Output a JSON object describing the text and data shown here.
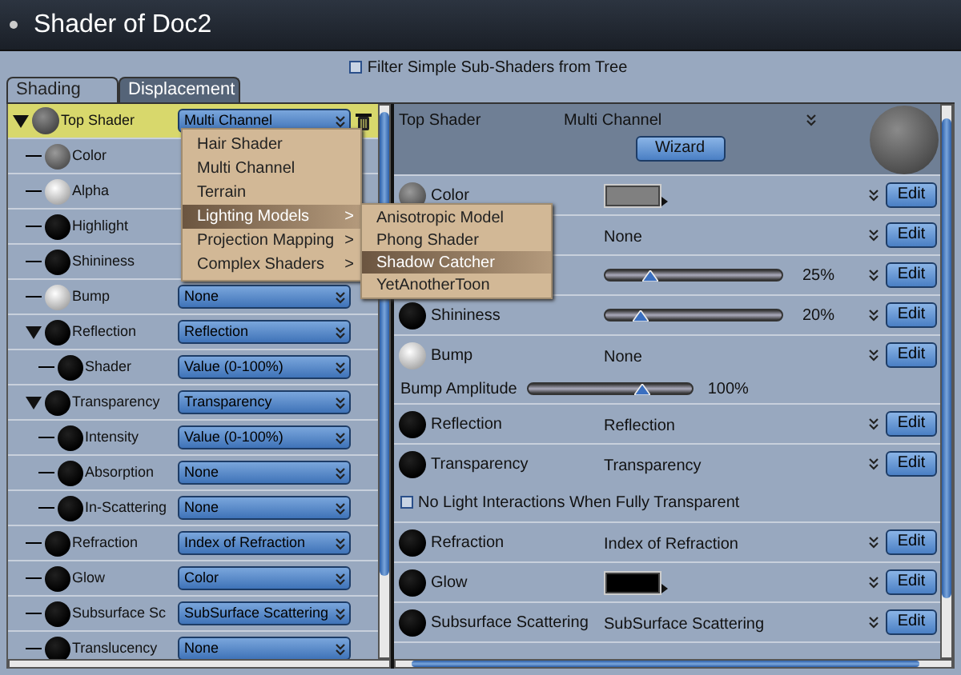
{
  "window": {
    "title": "Shader of Doc2"
  },
  "filter": {
    "label": "Filter Simple Sub-Shaders from Tree",
    "checked": false
  },
  "tabs": [
    {
      "label": "Shading",
      "selected": true
    },
    {
      "label": "Displacement",
      "selected": false
    }
  ],
  "tree": [
    {
      "label": "Top Shader",
      "sphere": {
        "kind": "dark"
      },
      "value": "Multi Channel",
      "selected": true,
      "expanded": true,
      "children": [
        {
          "label": "Color",
          "sphere": {
            "kind": "gray"
          },
          "selected": false
        },
        {
          "label": "Alpha",
          "sphere": {
            "kind": "white"
          },
          "selected": false
        },
        {
          "label": "Highlight",
          "sphere": {
            "kind": "black"
          },
          "selected": false
        },
        {
          "label": "Shininess",
          "sphere": {
            "kind": "black"
          },
          "selected": false
        },
        {
          "label": "Bump",
          "sphere": {
            "kind": "white"
          },
          "value": "None",
          "selected": false
        },
        {
          "label": "Reflection",
          "sphere": {
            "kind": "black"
          },
          "value": "Reflection",
          "selected": false,
          "expanded": true,
          "children": [
            {
              "label": "Shader",
              "sphere": {
                "kind": "black"
              },
              "value": "Value (0-100%)",
              "selected": false
            }
          ]
        },
        {
          "label": "Transparency",
          "sphere": {
            "kind": "black"
          },
          "value": "Transparency",
          "selected": false,
          "expanded": true,
          "children": [
            {
              "label": "Intensity",
              "sphere": {
                "kind": "black"
              },
              "value": "Value (0-100%)",
              "selected": false
            },
            {
              "label": "Absorption",
              "sphere": {
                "kind": "black"
              },
              "value": "None",
              "selected": false
            },
            {
              "label": "In-Scattering",
              "sphere": {
                "kind": "black"
              },
              "value": "None",
              "selected": false
            }
          ]
        },
        {
          "label": "Refraction",
          "sphere": {
            "kind": "black"
          },
          "value": "Index of Refraction",
          "selected": false
        },
        {
          "label": "Glow",
          "sphere": {
            "kind": "black"
          },
          "value": "Color",
          "selected": false
        },
        {
          "label": "Subsurface Sc",
          "sphere": {
            "kind": "black"
          },
          "value": "SubSurface Scattering",
          "selected": false
        },
        {
          "label": "Translucency",
          "sphere": {
            "kind": "black"
          },
          "value": "None",
          "selected": false
        }
      ]
    }
  ],
  "menu": {
    "items": [
      {
        "label": "Hair Shader",
        "submenu": false,
        "selected": false
      },
      {
        "label": "Multi Channel",
        "submenu": false,
        "selected": false
      },
      {
        "label": "Terrain",
        "submenu": false,
        "selected": false
      },
      {
        "label": "Lighting Models",
        "submenu": true,
        "selected": true
      },
      {
        "label": "Projection Mapping",
        "submenu": true,
        "selected": false
      },
      {
        "label": "Complex Shaders",
        "submenu": true,
        "selected": false
      }
    ],
    "arrow": ">",
    "submenu": [
      {
        "label": "Anisotropic Model",
        "selected": false
      },
      {
        "label": "Phong Shader",
        "selected": false
      },
      {
        "label": "Shadow Catcher",
        "selected": true
      },
      {
        "label": "YetAnotherToon",
        "selected": false
      }
    ]
  },
  "detail": {
    "title": "Top Shader",
    "value": "Multi Channel",
    "wizard": "Wizard",
    "rows": [
      {
        "kind": "swatch",
        "label": "Color",
        "sphere": {
          "kind": "gray"
        },
        "color": "#808080",
        "edit": "Edit"
      },
      {
        "kind": "value",
        "value": "None",
        "edit": "Edit"
      },
      {
        "kind": "slider",
        "level": 0.25,
        "reading": "25%",
        "edit": "Edit"
      },
      {
        "kind": "slider",
        "label": "Shininess",
        "sphere": {
          "kind": "black"
        },
        "level": 0.2,
        "reading": "20%",
        "edit": "Edit"
      },
      {
        "kind": "value",
        "label": "Bump",
        "sphere": {
          "kind": "white"
        },
        "value": "None",
        "edit": "Edit",
        "extra": {
          "kind": "slider",
          "label": "Bump Amplitude",
          "level": 0.7,
          "reading": "100%"
        }
      },
      {
        "kind": "value",
        "label": "Reflection",
        "sphere": {
          "kind": "black"
        },
        "value": "Reflection",
        "edit": "Edit"
      },
      {
        "kind": "value",
        "label": "Transparency",
        "sphere": {
          "kind": "black"
        },
        "value": "Transparency",
        "edit": "Edit",
        "extra": {
          "kind": "checkbox",
          "label": "No Light Interactions When Fully Transparent",
          "checked": false
        }
      },
      {
        "kind": "value",
        "label": "Refraction",
        "sphere": {
          "kind": "black"
        },
        "value": "Index of Refraction",
        "edit": "Edit"
      },
      {
        "kind": "swatch",
        "label": "Glow",
        "sphere": {
          "kind": "black"
        },
        "color": "#000000",
        "edit": "Edit"
      },
      {
        "kind": "value",
        "label": "Subsurface Scattering",
        "sphere": {
          "kind": "black"
        },
        "value": "SubSurface Scattering",
        "edit": "Edit"
      }
    ]
  }
}
